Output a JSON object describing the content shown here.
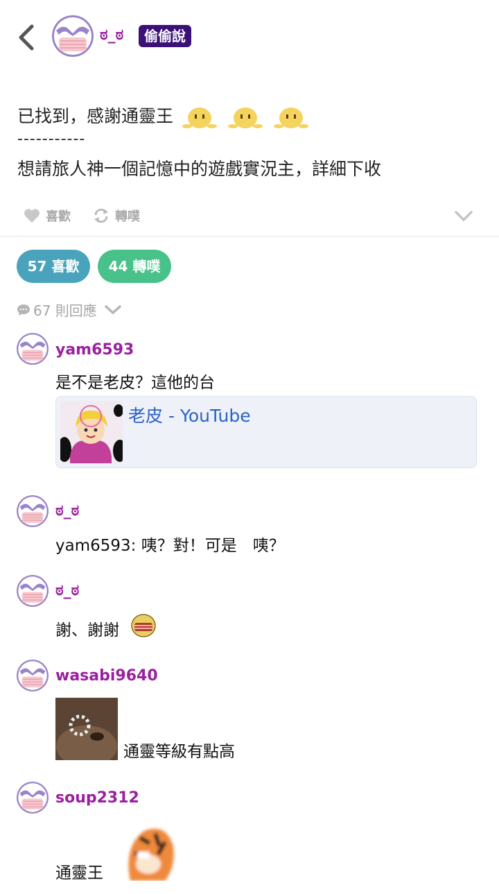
{
  "header": {
    "username": "ಠ_ಠ",
    "badge": "偷偷說"
  },
  "post": {
    "line1": "已找到，感謝通靈王",
    "separator": "-----------",
    "line2": "想請旅人神一個記憶中的遊戲實況主，詳細下收"
  },
  "actions": {
    "like_label": "喜歡",
    "replurk_label": "轉噗"
  },
  "stats": {
    "likes": "57 喜歡",
    "replurks": "44 轉噗"
  },
  "responses": {
    "count_label": "67 則回應"
  },
  "comments": [
    {
      "user": "yam6593",
      "text": "是不是老皮？這他的台",
      "link_title": "老皮 - YouTube"
    },
    {
      "user": "ಠ_ಠ",
      "text": "yam6593: 咦？對！可是　咦？"
    },
    {
      "user": "ಠ_ಠ",
      "text": "謝、謝謝"
    },
    {
      "user": "wasabi9640",
      "text": "通靈等級有點高"
    },
    {
      "user": "soup2312",
      "text": "通靈王"
    }
  ],
  "colors": {
    "username": "#9b1fa0",
    "badge_bg": "#3b1077",
    "like_pill": "#4aa3bd",
    "replurk_pill": "#48c18a",
    "link": "#2c62c4"
  }
}
